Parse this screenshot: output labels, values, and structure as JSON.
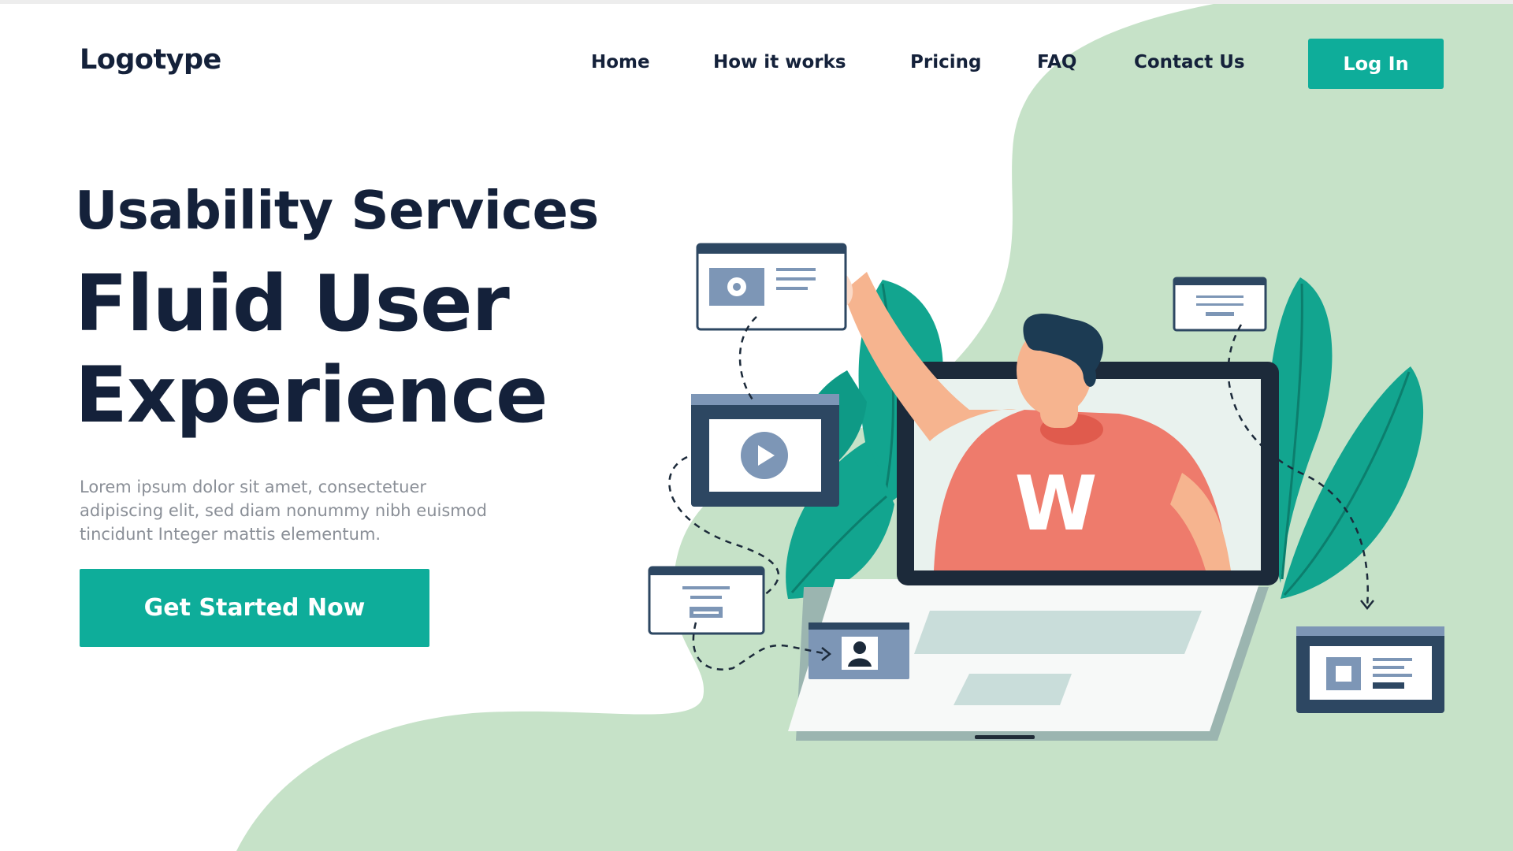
{
  "header": {
    "logo": "Logotype",
    "nav": [
      {
        "label": "Home",
        "name": "nav-home"
      },
      {
        "label": "How it works",
        "name": "nav-how-it-works"
      },
      {
        "label": "Pricing",
        "name": "nav-pricing"
      },
      {
        "label": "FAQ",
        "name": "nav-faq"
      },
      {
        "label": "Contact Us",
        "name": "nav-contact-us"
      }
    ],
    "login_label": "Log In"
  },
  "hero": {
    "subtitle": "Usability Services",
    "title_line1": "Fluid User",
    "title_line2": "Experience",
    "description_lines": [
      "Lorem ipsum dolor sit amet, consectetuer",
      "adipiscing elit, sed diam nonummy nibh euismod",
      "tincidunt Integer mattis elementum."
    ],
    "cta_label": "Get Started Now"
  },
  "illustration": {
    "shirt_letter": "W"
  },
  "colors": {
    "accent": "#0ead9a",
    "dark": "#14213a",
    "blob": "#c6e2c8",
    "leaf": "#12a58f",
    "shirt": "#ee7b6c"
  }
}
